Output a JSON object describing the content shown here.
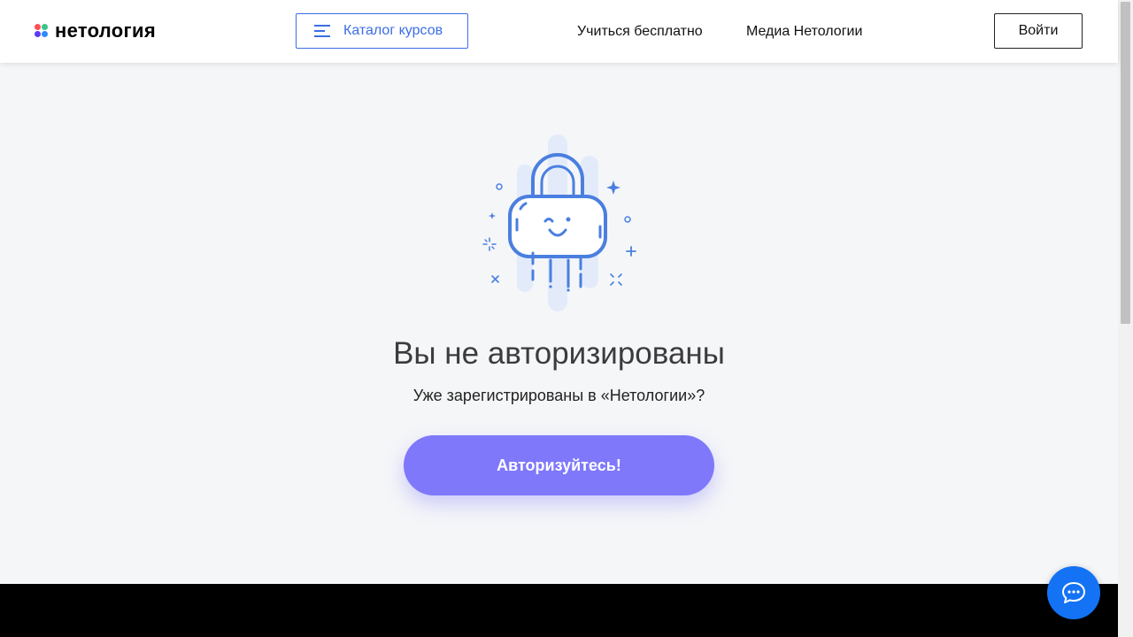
{
  "header": {
    "logo_text": "нетология",
    "catalog_button": "Каталог курсов",
    "nav": [
      "Учиться бесплатно",
      "Медиа Нетологии"
    ],
    "login_button": "Войти"
  },
  "main": {
    "title": "Вы не авторизированы",
    "subtitle": "Уже зарегистрированы в «Нетологии»?",
    "auth_button": "Авторизуйтесь!"
  },
  "icons": {
    "logo": "netology-logo-dots-icon",
    "catalog": "menu-icon",
    "illustration": "lock-icon",
    "chat": "chat-bubble-icon"
  },
  "colors": {
    "accent_blue": "#3b6ee6",
    "button_purple": "#7f78fb",
    "chat_blue": "#1472f5",
    "footer": "#000000",
    "background": "#f5f6f8"
  }
}
